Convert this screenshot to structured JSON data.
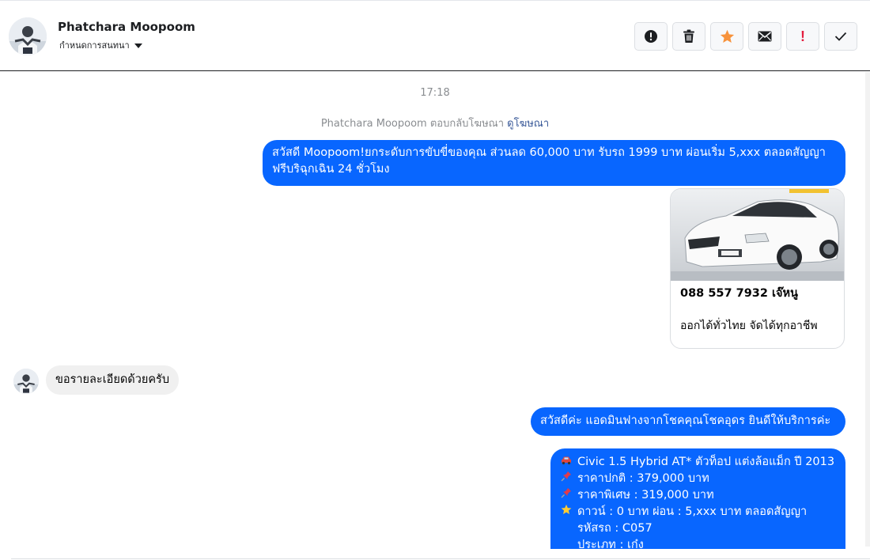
{
  "header": {
    "name": "Phatchara Moopoom",
    "subtitle": "กำหนดการสนทนา",
    "actions": [
      {
        "icon": "alert-circle-icon",
        "label": ""
      },
      {
        "icon": "trash-icon",
        "label": ""
      },
      {
        "icon": "star-icon",
        "label": ""
      },
      {
        "icon": "envelope-icon",
        "label": ""
      },
      {
        "icon": "exclamation-icon",
        "label": "!"
      },
      {
        "icon": "check-icon",
        "label": ""
      }
    ]
  },
  "thread": {
    "timestamp": "17:18",
    "ad_reply_text": "Phatchara Moopoom ตอบกลับโฆษณา",
    "ad_reply_link": "ดูโฆษณา",
    "msg1": "สวัสดี Moopoom!ยกระดับการขับขี่ของคุณ ส่วนลด 60,000 บาท รับรถ 1999 บาท  ผ่อนเริ่ม 5,xxx ตลอดสัญญา ฟรีบริฉุกเฉิน 24 ชั่วโมง",
    "card": {
      "badge": "",
      "title": "088 557 7932 เจ๊หนู",
      "desc": "ออกได้ทั่วไทย จัดได้ทุกอาชีพ"
    },
    "incoming": "ขอรายละเอียดด้วยครับ",
    "msg2": "สวัสดีค่ะ แอดมินฟางจากโชคคุณโชคอุดร ยินดีให้บริการค่ะ",
    "msg3_lines": [
      {
        "glyph": "car-icon",
        "text": "Civic 1.5 Hybrid AT* ตัวท็อป แต่งล้อแม็ก ปี 2013"
      },
      {
        "glyph": "pin-icon",
        "text": "ราคาปกติ : 379,000 บาท"
      },
      {
        "glyph": "pin-icon",
        "text": "ราคาพิเศษ : 319,000 บาท"
      },
      {
        "glyph": "star-icon",
        "text": "ดาวน์ : 0 บาท ผ่อน : 5,xxx บาท ตลอดสัญญา"
      },
      {
        "glyph": "",
        "text": "รหัสรถ : C057"
      },
      {
        "glyph": "",
        "text": "ประเภท : เก๋ง"
      }
    ]
  },
  "colors": {
    "accent_blue": "#0866ff",
    "star_orange": "#f7923b",
    "alert_red": "#e41e3f"
  }
}
